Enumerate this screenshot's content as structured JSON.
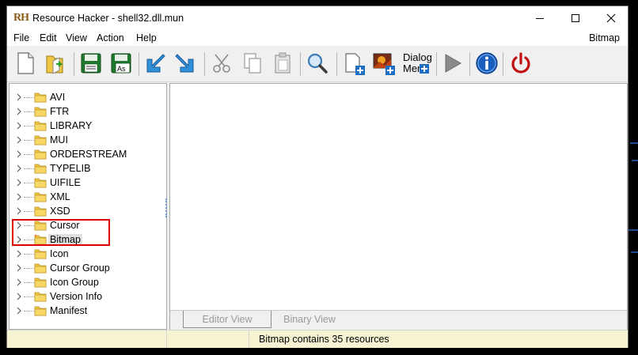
{
  "window": {
    "title": "Resource Hacker - shell32.dll.mun"
  },
  "menu": {
    "items": [
      "File",
      "Edit",
      "View",
      "Action",
      "Help"
    ],
    "context_label": "Bitmap"
  },
  "toolbar": {
    "dialog_merge_label_line1": "Dialog",
    "dialog_merge_label_line2": "Mer"
  },
  "tree": {
    "items": [
      {
        "label": "AVI"
      },
      {
        "label": "FTR"
      },
      {
        "label": "LIBRARY"
      },
      {
        "label": "MUI"
      },
      {
        "label": "ORDERSTREAM"
      },
      {
        "label": "TYPELIB"
      },
      {
        "label": "UIFILE"
      },
      {
        "label": "XML"
      },
      {
        "label": "XSD"
      },
      {
        "label": "Cursor"
      },
      {
        "label": "Bitmap",
        "selected": true
      },
      {
        "label": "Icon"
      },
      {
        "label": "Cursor Group"
      },
      {
        "label": "Icon Group"
      },
      {
        "label": "Version Info"
      },
      {
        "label": "Manifest"
      }
    ]
  },
  "tabs": {
    "editor_view": "Editor View",
    "binary_view": "Binary View"
  },
  "status": {
    "message": "Bitmap contains 35 resources"
  },
  "colors": {
    "highlight_box": "#e00000",
    "status_bg": "#f5f3d2",
    "folder_yellow": "#f2c744"
  }
}
